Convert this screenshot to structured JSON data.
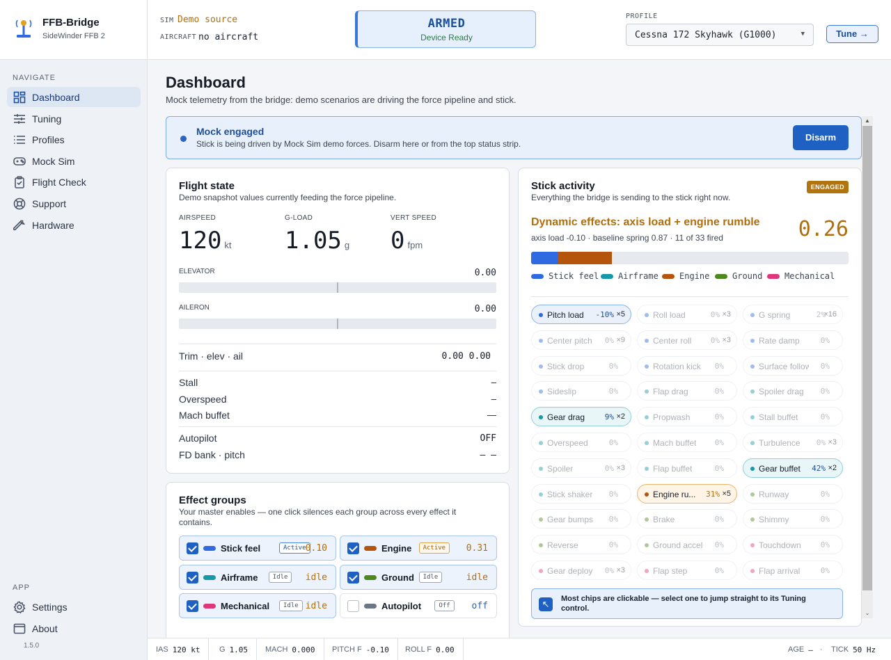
{
  "brand": {
    "title": "FFB-Bridge",
    "subtitle": "SideWinder FFB 2"
  },
  "sidebar": {
    "nav_heading": "NAVIGATE",
    "items": [
      {
        "label": "Dashboard",
        "icon": "dashboard-icon",
        "active": true
      },
      {
        "label": "Tuning",
        "icon": "sliders-icon"
      },
      {
        "label": "Profiles",
        "icon": "list-icon"
      },
      {
        "label": "Mock Sim",
        "icon": "gamepad-icon"
      },
      {
        "label": "Flight Check",
        "icon": "clipboard-icon"
      },
      {
        "label": "Support",
        "icon": "lifebuoy-icon"
      },
      {
        "label": "Hardware",
        "icon": "wrench-icon"
      }
    ],
    "app_heading": "APP",
    "app_items": [
      {
        "label": "Settings",
        "icon": "gear-icon"
      },
      {
        "label": "About",
        "icon": "window-icon"
      }
    ],
    "version": "1.5.0"
  },
  "header": {
    "sim_key": "SIM",
    "sim_value": "Demo source",
    "aircraft_key": "AIRCRAFT",
    "aircraft_value": "no aircraft",
    "status": "ARMED",
    "status_sub": "Device Ready",
    "profile_key": "PROFILE",
    "profile_value": "Cessna 172 Skyhawk (G1000)",
    "tune_label": "Tune →"
  },
  "page": {
    "title": "Dashboard",
    "subtitle": "Mock telemetry from the bridge: demo scenarios are driving the force pipeline and stick."
  },
  "banner": {
    "title": "Mock engaged",
    "text": "Stick is being driven by Mock Sim demo forces. Disarm here or from the top status strip.",
    "button": "Disarm"
  },
  "flight": {
    "title": "Flight state",
    "subtitle": "Demo snapshot values currently feeding the force pipeline.",
    "airspeed_label": "AIRSPEED",
    "airspeed": "120",
    "airspeed_unit": "kt",
    "gload_label": "G-LOAD",
    "gload": "1.05",
    "gload_unit": "g",
    "vs_label": "VERT SPEED",
    "vs": "0",
    "vs_unit": "fpm",
    "elevator_label": "ELEVATOR",
    "elevator": "0.00",
    "aileron_label": "AILERON",
    "aileron": "0.00",
    "trim_label": "Trim · elev · ail",
    "trim_value": "0.00 0.00",
    "stall_label": "Stall",
    "stall_value": "–",
    "overspeed_label": "Overspeed",
    "overspeed_value": "–",
    "mach_label": "Mach buffet",
    "mach_value": "—",
    "ap_label": "Autopilot",
    "ap_value": "OFF",
    "fd_label": "FD bank · pitch",
    "fd_value": "— —"
  },
  "groups": {
    "title": "Effect groups",
    "subtitle": "Your master enables — one click silences each group across every effect it contains.",
    "items": [
      {
        "name": "Stick feel",
        "badge": "Active",
        "value": "0.10",
        "color": "#2f6ae0",
        "checked": true
      },
      {
        "name": "Engine",
        "badge": "Active",
        "value": "0.31",
        "color": "#b5540c",
        "checked": true
      },
      {
        "name": "Airframe",
        "badge": "Idle",
        "value": "idle",
        "color": "#1798a8",
        "checked": true
      },
      {
        "name": "Ground",
        "badge": "Idle",
        "value": "idle",
        "color": "#4c8a1c",
        "checked": true
      },
      {
        "name": "Mechanical",
        "badge": "Idle",
        "value": "idle",
        "color": "#e0367d",
        "checked": true
      },
      {
        "name": "Autopilot",
        "badge": "Off",
        "value": "off",
        "color": "#6b7585",
        "checked": false
      }
    ]
  },
  "stick": {
    "title": "Stick activity",
    "subtitle": "Everything the bridge is sending to the stick right now.",
    "badge": "ENGAGED",
    "dyn_title": "Dynamic effects: axis load + engine rumble",
    "dyn_sub": "axis load -0.10 · baseline spring 0.87 · 11 of 33 fired",
    "dyn_value": "0.26",
    "bar": [
      {
        "group": "Stick feel",
        "fraction": 0.085,
        "color": "#2f6ae0"
      },
      {
        "group": "Engine",
        "fraction": 0.17,
        "color": "#b5540c"
      }
    ],
    "legend": [
      {
        "name": "Stick feel",
        "color": "#2f6ae0"
      },
      {
        "name": "Airframe",
        "color": "#1798a8"
      },
      {
        "name": "Engine",
        "color": "#b5540c"
      },
      {
        "name": "Ground",
        "color": "#4c8a1c"
      },
      {
        "name": "Mechanical",
        "color": "#e0367d"
      }
    ],
    "chips": [
      {
        "name": "Pitch load",
        "pct": "-10%",
        "mult": "×5",
        "color": "#2f6ae0",
        "state": "hot"
      },
      {
        "name": "Roll load",
        "pct": "0%",
        "mult": "×3",
        "color": "#2f6ae0",
        "state": "dim"
      },
      {
        "name": "G spring",
        "pct": "2%",
        "mult": "×16",
        "color": "#2f6ae0",
        "state": "dim"
      },
      {
        "name": "Center pitch",
        "pct": "0%",
        "mult": "×9",
        "color": "#2f6ae0",
        "state": "dim"
      },
      {
        "name": "Center roll",
        "pct": "0%",
        "mult": "×3",
        "color": "#2f6ae0",
        "state": "dim"
      },
      {
        "name": "Rate damp",
        "pct": "0%",
        "mult": "",
        "color": "#2f6ae0",
        "state": "dim"
      },
      {
        "name": "Stick drop",
        "pct": "0%",
        "mult": "",
        "color": "#2f6ae0",
        "state": "dim"
      },
      {
        "name": "Rotation kick",
        "pct": "0%",
        "mult": "",
        "color": "#2f6ae0",
        "state": "dim"
      },
      {
        "name": "Surface follow",
        "pct": "0%",
        "mult": "",
        "color": "#2f6ae0",
        "state": "dim"
      },
      {
        "name": "Sideslip",
        "pct": "0%",
        "mult": "",
        "color": "#2f6ae0",
        "state": "dim"
      },
      {
        "name": "Flap drag",
        "pct": "0%",
        "mult": "",
        "color": "#1798a8",
        "state": "dim"
      },
      {
        "name": "Spoiler drag",
        "pct": "0%",
        "mult": "",
        "color": "#1798a8",
        "state": "dim"
      },
      {
        "name": "Gear drag",
        "pct": "9%",
        "mult": "×2",
        "color": "#1798a8",
        "state": "hot-cyan"
      },
      {
        "name": "Propwash",
        "pct": "0%",
        "mult": "",
        "color": "#1798a8",
        "state": "dim"
      },
      {
        "name": "Stall buffet",
        "pct": "0%",
        "mult": "",
        "color": "#1798a8",
        "state": "dim"
      },
      {
        "name": "Overspeed",
        "pct": "0%",
        "mult": "",
        "color": "#1798a8",
        "state": "dim"
      },
      {
        "name": "Mach buffet",
        "pct": "0%",
        "mult": "",
        "color": "#1798a8",
        "state": "dim"
      },
      {
        "name": "Turbulence",
        "pct": "0%",
        "mult": "×3",
        "color": "#1798a8",
        "state": "dim"
      },
      {
        "name": "Spoiler",
        "pct": "0%",
        "mult": "×3",
        "color": "#1798a8",
        "state": "dim"
      },
      {
        "name": "Flap buffet",
        "pct": "0%",
        "mult": "",
        "color": "#1798a8",
        "state": "dim"
      },
      {
        "name": "Gear buffet",
        "pct": "42%",
        "mult": "×2",
        "color": "#1798a8",
        "state": "hot-cyan"
      },
      {
        "name": "Stick shaker",
        "pct": "0%",
        "mult": "",
        "color": "#1798a8",
        "state": "dim"
      },
      {
        "name": "Engine ru...",
        "pct": "31%",
        "mult": "×5",
        "color": "#b5540c",
        "state": "hot-orange"
      },
      {
        "name": "Runway",
        "pct": "0%",
        "mult": "",
        "color": "#4c8a1c",
        "state": "dim"
      },
      {
        "name": "Gear bumps",
        "pct": "0%",
        "mult": "",
        "color": "#4c8a1c",
        "state": "dim"
      },
      {
        "name": "Brake",
        "pct": "0%",
        "mult": "",
        "color": "#4c8a1c",
        "state": "dim"
      },
      {
        "name": "Shimmy",
        "pct": "0%",
        "mult": "",
        "color": "#4c8a1c",
        "state": "dim"
      },
      {
        "name": "Reverse",
        "pct": "0%",
        "mult": "",
        "color": "#4c8a1c",
        "state": "dim"
      },
      {
        "name": "Ground accel",
        "pct": "0%",
        "mult": "",
        "color": "#4c8a1c",
        "state": "dim"
      },
      {
        "name": "Touchdown",
        "pct": "0%",
        "mult": "",
        "color": "#e0367d",
        "state": "dim"
      },
      {
        "name": "Gear deploy",
        "pct": "0%",
        "mult": "×3",
        "color": "#e0367d",
        "state": "dim"
      },
      {
        "name": "Flap step",
        "pct": "0%",
        "mult": "",
        "color": "#e0367d",
        "state": "dim"
      },
      {
        "name": "Flap arrival",
        "pct": "0%",
        "mult": "",
        "color": "#e0367d",
        "state": "dim"
      }
    ],
    "hint": "Most chips are clickable — select one to jump straight to its Tuning control."
  },
  "footer": {
    "ias_k": "IAS",
    "ias_v": "120 kt",
    "g_k": "G",
    "g_v": "1.05",
    "mach_k": "MACH",
    "mach_v": "0.000",
    "pitch_k": "PITCH F",
    "pitch_v": "-0.10",
    "roll_k": "ROLL F",
    "roll_v": "0.00",
    "age_k": "AGE",
    "age_v": "—",
    "tick_k": "TICK",
    "tick_v": "50 Hz"
  }
}
